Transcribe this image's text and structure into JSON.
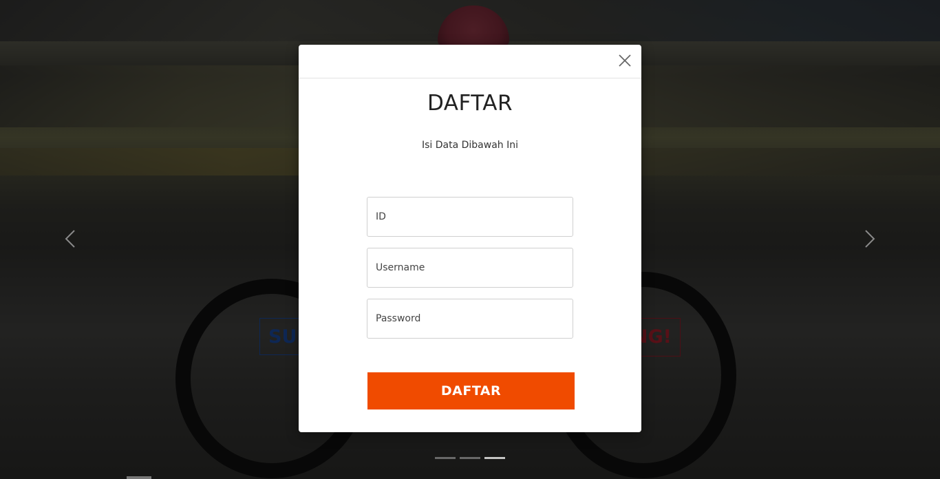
{
  "modal": {
    "title": "DAFTAR",
    "subtitle": "Isi Data Dibawah Ini",
    "fields": {
      "id_placeholder": "ID",
      "username_placeholder": "Username",
      "password_placeholder": "Password"
    },
    "submit_label": "DAFTAR",
    "close_icon": "close-icon",
    "accent_color": "#f04b00"
  },
  "background": {
    "banner_left_text": "SUD",
    "banner_right_text": "NG!",
    "banner_left_color": "#1d4fa8",
    "banner_right_color": "#b0202e"
  },
  "carousel": {
    "prev_icon": "chevron-left-icon",
    "next_icon": "chevron-right-icon",
    "indicator_count": 3,
    "active_indicator": 3
  }
}
